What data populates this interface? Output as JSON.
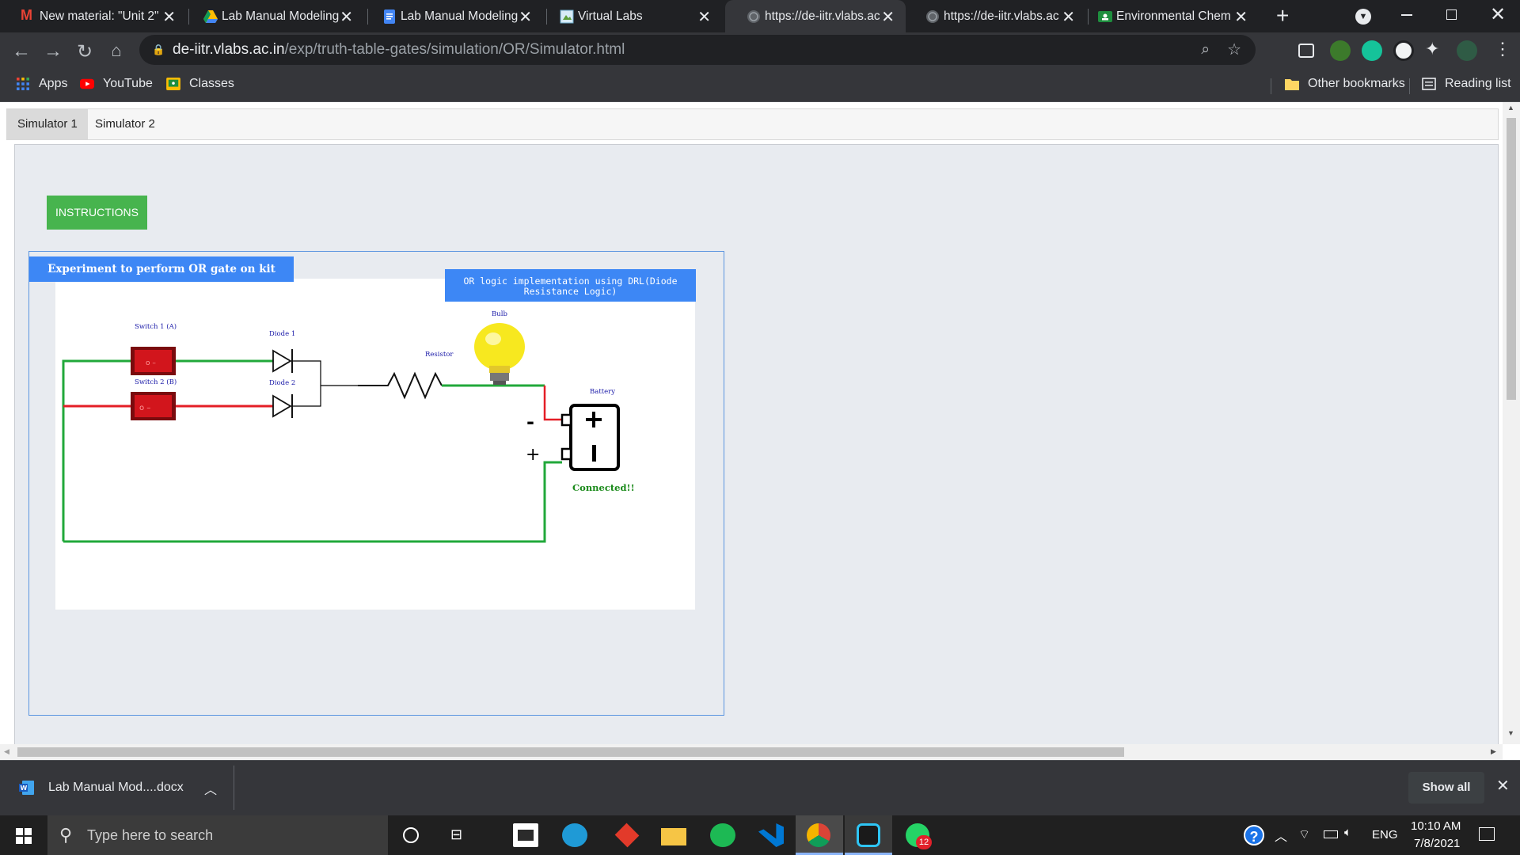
{
  "browser": {
    "tabs": [
      {
        "title": "New material: \"Unit 2\"",
        "favicon": "gmail-icon",
        "color": "#ea4335"
      },
      {
        "title": "Lab Manual Modeling",
        "favicon": "drive-icon",
        "color": "#fbbc04"
      },
      {
        "title": "Lab Manual Modeling",
        "favicon": "docs-icon",
        "color": "#4285f4"
      },
      {
        "title": "Virtual Labs",
        "favicon": "page-icon",
        "color": "#9ad0ec"
      },
      {
        "title": "https://de-iitr.vlabs.ac",
        "favicon": "globe-icon",
        "color": "#9aa0a6"
      },
      {
        "title": "https://de-iitr.vlabs.ac",
        "favicon": "globe-icon",
        "color": "#9aa0a6"
      },
      {
        "title": "Environmental Chemi",
        "favicon": "classroom-icon",
        "color": "#1e8e3e"
      }
    ],
    "active_tab": 4,
    "url_host": "de-iitr.vlabs.ac.in",
    "url_path": "/exp/truth-table-gates/simulation/OR/Simulator.html",
    "bookmarks": [
      {
        "label": "Apps",
        "icon": "apps-grid-icon"
      },
      {
        "label": "YouTube",
        "icon": "youtube-icon"
      },
      {
        "label": "Classes",
        "icon": "classroom-icon"
      }
    ],
    "other_bookmarks": "Other bookmarks",
    "reading_list": "Reading list"
  },
  "page": {
    "sim_tabs": [
      "Simulator 1",
      "Simulator 2"
    ],
    "instructions_button": "INSTRUCTIONS",
    "experiment_title": "Experiment to perform OR gate on kit",
    "logic_title": "OR logic implementation using DRL(Diode Resistance Logic)",
    "labels": {
      "switch1": "Switch 1 (A)",
      "switch2": "Switch 2 (B)",
      "diode1": "Diode 1",
      "diode2": "Diode 2",
      "resistor": "Resistor",
      "bulb": "Bulb",
      "battery": "Battery",
      "minus": "-",
      "plus": "+",
      "status": "Connected!!"
    },
    "colors": {
      "wire_on": "#21a83a",
      "wire_off": "#e41e26",
      "header": "#3d87f5",
      "instr": "#47b44e",
      "status": "#1a8a1a"
    }
  },
  "download": {
    "file": "Lab Manual Mod....docx",
    "show_all": "Show all"
  },
  "taskbar": {
    "search_placeholder": "Type here to search",
    "lang": "ENG",
    "time": "10:10 AM",
    "date": "7/8/2021",
    "whatsapp_badge": "12"
  }
}
